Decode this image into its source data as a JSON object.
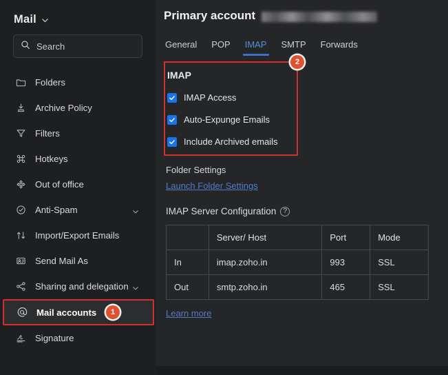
{
  "sidebar": {
    "brand": {
      "title": "Mail",
      "chevron_icon": "chevron-down-icon"
    },
    "search": {
      "placeholder": "Search",
      "icon": "search-icon"
    },
    "items": [
      {
        "label": "Folders",
        "icon": "folder-icon",
        "expandable": false,
        "selected": false
      },
      {
        "label": "Archive Policy",
        "icon": "archive-icon",
        "expandable": false,
        "selected": false
      },
      {
        "label": "Filters",
        "icon": "filter-icon",
        "expandable": false,
        "selected": false
      },
      {
        "label": "Hotkeys",
        "icon": "command-key-icon",
        "expandable": false,
        "selected": false
      },
      {
        "label": "Out of office",
        "icon": "out-of-office-icon",
        "expandable": false,
        "selected": false
      },
      {
        "label": "Anti-Spam",
        "icon": "shield-check-icon",
        "expandable": true,
        "selected": false
      },
      {
        "label": "Import/Export Emails",
        "icon": "import-export-icon",
        "expandable": false,
        "selected": false
      },
      {
        "label": "Send Mail As",
        "icon": "send-mail-as-icon",
        "expandable": false,
        "selected": false
      },
      {
        "label": "Sharing and delegation",
        "icon": "share-icon",
        "expandable": true,
        "selected": false
      },
      {
        "label": "Mail accounts",
        "icon": "at-sign-icon",
        "expandable": false,
        "selected": true,
        "badge": "1"
      },
      {
        "label": "Signature",
        "icon": "signature-icon",
        "expandable": false,
        "selected": false
      }
    ]
  },
  "main": {
    "account_heading": "Primary account",
    "account_email_redacted": true,
    "tabs": [
      {
        "label": "General",
        "active": false
      },
      {
        "label": "POP",
        "active": false
      },
      {
        "label": "IMAP",
        "active": true
      },
      {
        "label": "SMTP",
        "active": false
      },
      {
        "label": "Forwards",
        "active": false
      }
    ],
    "imap_section": {
      "title": "IMAP",
      "badge": "2",
      "checkboxes": [
        {
          "label": "IMAP Access",
          "checked": true
        },
        {
          "label": "Auto-Expunge Emails",
          "checked": true
        },
        {
          "label": "Include Archived emails",
          "checked": true
        }
      ]
    },
    "folder_settings": {
      "title": "Folder Settings",
      "link_label": "Launch Folder Settings"
    },
    "server_config": {
      "title": "IMAP Server Configuration",
      "help_icon": "question-mark-icon",
      "columns": [
        "",
        "Server/ Host",
        "Port",
        "Mode"
      ],
      "rows": [
        {
          "direction": "In",
          "host": "imap.zoho.in",
          "port": "993",
          "mode": "SSL"
        },
        {
          "direction": "Out",
          "host": "smtp.zoho.in",
          "port": "465",
          "mode": "SSL"
        }
      ]
    },
    "learn_more_label": "Learn more"
  },
  "colors": {
    "accent_blue": "#1a73e8",
    "tab_active": "#5b8fd8",
    "link": "#5578c8",
    "highlight_red": "#d32f2f",
    "badge_orange": "#e0512f",
    "sidebar_bg": "#1e1f21",
    "main_bg": "#252628"
  }
}
